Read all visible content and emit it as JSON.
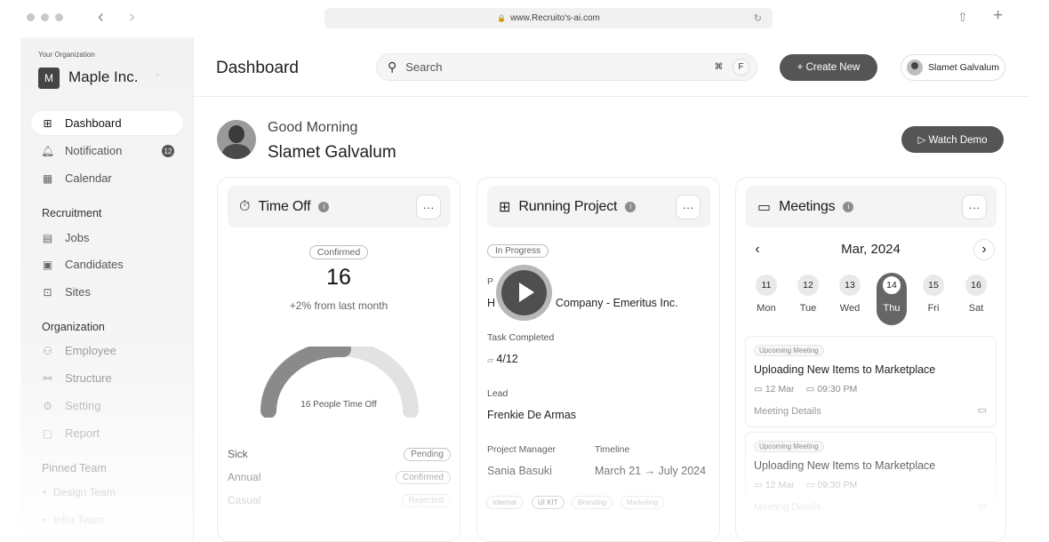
{
  "browser": {
    "url": "www.Recruito's-ai.com"
  },
  "sidebar": {
    "org_label": "Your Organization",
    "org_initial": "M",
    "org_name": "Maple Inc.",
    "main_items": [
      {
        "label": "Dashboard",
        "icon": "grid-icon"
      },
      {
        "label": "Notification",
        "icon": "bell-icon",
        "badge": "12"
      },
      {
        "label": "Calendar",
        "icon": "calendar-icon"
      }
    ],
    "sections": {
      "recruitment": "Recruitment",
      "organization": "Organization",
      "pinned": "Pinned Team"
    },
    "recruitment_items": [
      {
        "label": "Jobs",
        "icon": "clipboard-icon"
      },
      {
        "label": "Candidates",
        "icon": "id-card-icon"
      },
      {
        "label": "Sites",
        "icon": "sites-icon"
      }
    ],
    "organization_items": [
      {
        "label": "Employee",
        "icon": "people-icon"
      },
      {
        "label": "Structure",
        "icon": "hierarchy-icon"
      },
      {
        "label": "Setting",
        "icon": "gear-icon"
      },
      {
        "label": "Report",
        "icon": "report-icon"
      }
    ],
    "pinned_items": [
      {
        "label": "Design Team"
      },
      {
        "label": "Infra Team"
      }
    ]
  },
  "header": {
    "title": "Dashboard",
    "search_placeholder": "Search",
    "shortcut_key1": "⌘",
    "shortcut_key2": "F",
    "create_label": "+ Create New",
    "user_name": "Slamet Galvalum"
  },
  "greeting": {
    "salutation": "Good Morning",
    "name": "Slamet Galvalum",
    "watch_demo": "▷ Watch Demo"
  },
  "time_off": {
    "title": "Time Off",
    "status": "Confirmed",
    "count": "16",
    "change": "+2% from last month",
    "gauge_label": "16 People Time Off",
    "leaves": [
      {
        "type": "Sick",
        "status": "Pending"
      },
      {
        "type": "Annual",
        "status": "Confirmed"
      },
      {
        "type": "Casual",
        "status": "Rejected"
      }
    ]
  },
  "project": {
    "title": "Running Project",
    "status": "In Progress",
    "project_label": "P",
    "project_name_start": "H",
    "project_name_end": "Company - Emeritus Inc.",
    "task_label": "Task Completed",
    "task_value": "4/12",
    "lead_label": "Lead",
    "lead_value": "Frenkie De Armas",
    "manager_label": "Project Manager",
    "manager_value": "Sania Basuki",
    "timeline_label": "Timeline",
    "timeline_value": "March 21 → July 2024",
    "tags": [
      "Internal",
      "UI KIT",
      "Branding",
      "Marketing"
    ]
  },
  "meetings": {
    "title": "Meetings",
    "month": "Mar, 2024",
    "days": [
      {
        "num": "11",
        "name": "Mon"
      },
      {
        "num": "12",
        "name": "Tue"
      },
      {
        "num": "13",
        "name": "Wed"
      },
      {
        "num": "14",
        "name": "Thu",
        "active": true
      },
      {
        "num": "15",
        "name": "Fri"
      },
      {
        "num": "16",
        "name": "Sat"
      }
    ],
    "items": [
      {
        "badge": "Upcoming Meeting",
        "title": "Uploading New Items to Marketplace",
        "date": "12 Mar",
        "time": "09:30 PM",
        "link": "Meeting Details"
      },
      {
        "badge": "Upcoming Meeting",
        "title": "Uploading New Items to Marketplace",
        "date": "12 Mar",
        "time": "09:30 PM",
        "link": "Meeting Details"
      }
    ]
  }
}
